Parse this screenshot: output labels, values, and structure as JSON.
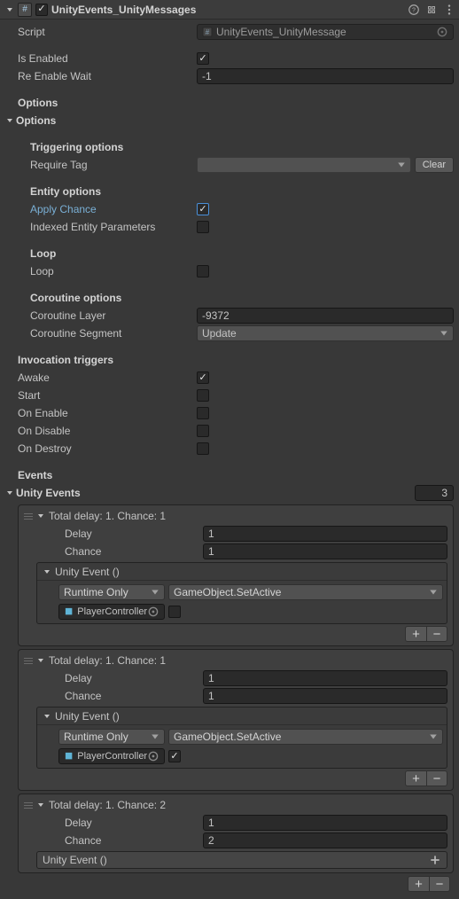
{
  "header": {
    "title": "UnityEvents_UnityMessages",
    "component_enabled": true
  },
  "script": {
    "label": "Script",
    "value": "UnityEvents_UnityMessage"
  },
  "is_enabled": {
    "label": "Is Enabled",
    "checked": true
  },
  "re_enable_wait": {
    "label": "Re Enable Wait",
    "value": "-1"
  },
  "options_header": "Options",
  "options_foldout": "Options",
  "triggering": {
    "header": "Triggering options",
    "require_tag_label": "Require Tag",
    "clear_btn": "Clear"
  },
  "entity": {
    "header": "Entity options",
    "apply_chance_label": "Apply Chance",
    "apply_chance_checked": true,
    "indexed_label": "Indexed Entity Parameters",
    "indexed_checked": false
  },
  "loop": {
    "header": "Loop",
    "label": "Loop",
    "checked": false
  },
  "coroutine": {
    "header": "Coroutine options",
    "layer_label": "Coroutine Layer",
    "layer_value": "-9372",
    "segment_label": "Coroutine Segment",
    "segment_value": "Update"
  },
  "invocation": {
    "header": "Invocation triggers",
    "awake": {
      "label": "Awake",
      "checked": true
    },
    "start": {
      "label": "Start",
      "checked": false
    },
    "on_enable": {
      "label": "On Enable",
      "checked": false
    },
    "on_disable": {
      "label": "On Disable",
      "checked": false
    },
    "on_destroy": {
      "label": "On Destroy",
      "checked": false
    }
  },
  "events": {
    "header": "Events",
    "foldout": "Unity Events",
    "count": "3",
    "delay_label": "Delay",
    "chance_label": "Chance",
    "unity_event_label": "Unity Event ()",
    "runtime_only": "Runtime Only",
    "method": "GameObject.SetActive",
    "obj_name": "PlayerController",
    "items": [
      {
        "title": "Total delay: 1. Chance: 1",
        "delay": "1",
        "chance": "1",
        "bool_checked": false,
        "show_body": true
      },
      {
        "title": "Total delay: 1. Chance: 1",
        "delay": "1",
        "chance": "1",
        "bool_checked": true,
        "show_body": true
      },
      {
        "title": "Total delay: 1. Chance: 2",
        "delay": "1",
        "chance": "2",
        "bool_checked": false,
        "show_body": false
      }
    ]
  }
}
